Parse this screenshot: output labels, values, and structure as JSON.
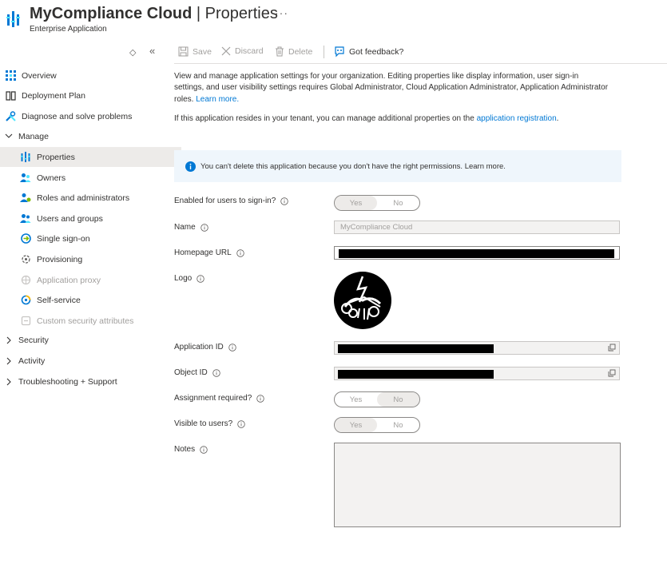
{
  "header": {
    "app_name": "MyCompliance Cloud",
    "separator": " | ",
    "page_title": "Properties",
    "subtitle": "Enterprise Application",
    "more": "···"
  },
  "sidebar": {
    "restore_label": "◇",
    "collapse_label": "«",
    "items": [
      {
        "label": "Overview",
        "icon": "overview-grid-icon"
      },
      {
        "label": "Deployment Plan",
        "icon": "book-icon"
      },
      {
        "label": "Diagnose and solve problems",
        "icon": "wrench-icon"
      },
      {
        "label": "Manage",
        "icon": "chevron-down-icon"
      },
      {
        "label": "Properties",
        "icon": "properties-icon"
      },
      {
        "label": "Owners",
        "icon": "owners-icon"
      },
      {
        "label": "Roles and administrators",
        "icon": "roles-icon"
      },
      {
        "label": "Users and groups",
        "icon": "users-groups-icon"
      },
      {
        "label": "Single sign-on",
        "icon": "sso-icon"
      },
      {
        "label": "Provisioning",
        "icon": "provisioning-icon"
      },
      {
        "label": "Application proxy",
        "icon": "app-proxy-icon"
      },
      {
        "label": "Self-service",
        "icon": "self-service-icon"
      },
      {
        "label": "Custom security attributes",
        "icon": "custom-attributes-icon"
      },
      {
        "label": "Security",
        "icon": "chevron-right-icon"
      },
      {
        "label": "Activity",
        "icon": "chevron-right-icon"
      },
      {
        "label": "Troubleshooting + Support",
        "icon": "chevron-right-icon"
      }
    ]
  },
  "toolbar": {
    "save": "Save",
    "discard": "Discard",
    "delete": "Delete",
    "feedback": "Got feedback?"
  },
  "description": {
    "text": "View and manage application settings for your organization. Editing properties like display information, user sign-in settings, and user visibility settings requires Global Administrator, Cloud Application Administrator, Application Administrator roles.",
    "learn_more": "Learn more.",
    "tenant_text": "If this application resides in your tenant, you can manage additional properties on the",
    "tenant_link": "application registration",
    "tenant_end": "."
  },
  "info_banner": {
    "message": "You can't delete this application because you don't have the right permissions. Learn more."
  },
  "form": {
    "enabled_label": "Enabled for users to sign-in?",
    "enabled_yes": "Yes",
    "enabled_no": "No",
    "enabled_value": "Yes",
    "name_label": "Name",
    "name_value": "MyCompliance Cloud",
    "homepage_label": "Homepage URL",
    "logo_label": "Logo",
    "app_id_label": "Application ID",
    "object_id_label": "Object ID",
    "assignment_label": "Assignment required?",
    "assignment_yes": "Yes",
    "assignment_no": "No",
    "assignment_value": "No",
    "visible_label": "Visible to users?",
    "visible_yes": "Yes",
    "visible_no": "No",
    "visible_value": "Yes",
    "notes_label": "Notes",
    "notes_value": ""
  },
  "colors": {
    "accent": "#0078d4",
    "selected_bg": "#edebe9",
    "banner_bg": "#eff6fc"
  }
}
